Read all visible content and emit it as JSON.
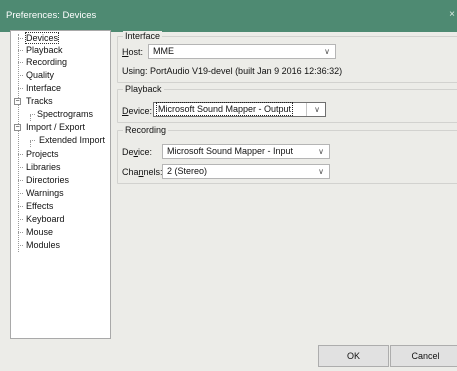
{
  "window": {
    "title": "Preferences: Devices",
    "close_glyph": "×"
  },
  "sidebar": {
    "items": [
      {
        "label": "Devices"
      },
      {
        "label": "Playback"
      },
      {
        "label": "Recording"
      },
      {
        "label": "Quality"
      },
      {
        "label": "Interface"
      },
      {
        "label": "Tracks"
      },
      {
        "label": "Spectrograms"
      },
      {
        "label": "Import / Export"
      },
      {
        "label": "Extended Import"
      },
      {
        "label": "Projects"
      },
      {
        "label": "Libraries"
      },
      {
        "label": "Directories"
      },
      {
        "label": "Warnings"
      },
      {
        "label": "Effects"
      },
      {
        "label": "Keyboard"
      },
      {
        "label": "Mouse"
      },
      {
        "label": "Modules"
      }
    ]
  },
  "interface_group": {
    "title": "Interface",
    "host_label_u": "H",
    "host_label_rest": "ost:",
    "host_value": "MME",
    "using_text": "Using: PortAudio V19-devel (built Jan  9 2016 12:36:32)"
  },
  "playback_group": {
    "title": "Playback",
    "device_label_u": "D",
    "device_label_rest": "evice:",
    "device_value": "Microsoft Sound Mapper - Output"
  },
  "recording_group": {
    "title": "Recording",
    "device_label_pre": "De",
    "device_label_u": "v",
    "device_label_rest": "ice:",
    "device_value": "Microsoft Sound Mapper - Input",
    "channels_label_pre": "Cha",
    "channels_label_u": "n",
    "channels_label_rest": "nels:",
    "channels_value": "2 (Stereo)"
  },
  "buttons": {
    "ok": "OK",
    "cancel": "Cancel"
  },
  "colors": {
    "titlebar": "#4e8a72",
    "window_bg": "#ecece8"
  }
}
